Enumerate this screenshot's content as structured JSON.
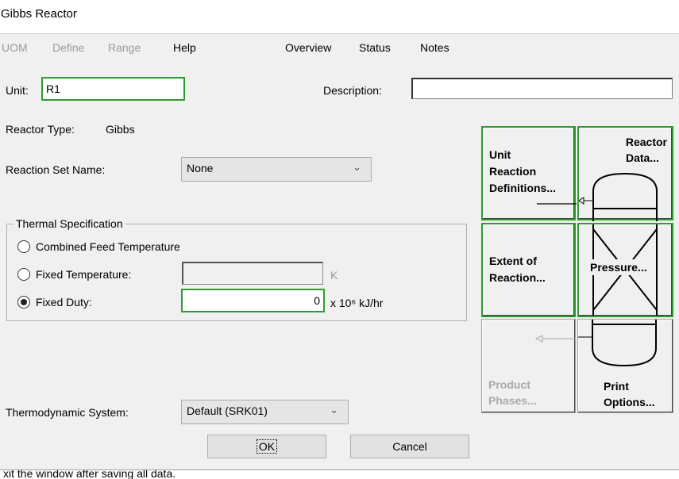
{
  "window": {
    "title": "Gibbs Reactor"
  },
  "menu": {
    "uom": "UOM",
    "define": "Define",
    "range": "Range",
    "help": "Help",
    "overview": "Overview",
    "status": "Status",
    "notes": "Notes"
  },
  "form": {
    "unit_label": "Unit:",
    "unit_value": "R1",
    "description_label": "Description:",
    "description_value": "",
    "reactor_type_label": "Reactor Type:",
    "reactor_type_value": "Gibbs",
    "reaction_set_label": "Reaction Set Name:",
    "reaction_set_value": "None",
    "thermo_label": "Thermodynamic System:",
    "thermo_value": "Default (SRK01)"
  },
  "thermal": {
    "group_label": "Thermal Specification",
    "combined_feed": "Combined Feed Temperature",
    "fixed_temp": "Fixed Temperature:",
    "fixed_temp_value": "",
    "fixed_temp_unit": "K",
    "fixed_duty": "Fixed Duty:",
    "fixed_duty_value": "0",
    "fixed_duty_unit": "x 10⁶ kJ/hr",
    "selected": "fixed_duty"
  },
  "buttons": {
    "ok": "OK",
    "cancel": "Cancel"
  },
  "tiles": {
    "unit_reaction": [
      "Unit",
      "Reaction",
      "Definitions..."
    ],
    "reactor_data": [
      "Reactor",
      "Data..."
    ],
    "extent": [
      "Extent of",
      "Reaction..."
    ],
    "pressure": "Pressure...",
    "product_phases": [
      "Product",
      "Phases..."
    ],
    "print_options": [
      "Print",
      "Options..."
    ]
  },
  "statusbar": {
    "text": "xit the window after saving all data."
  },
  "colors": {
    "accent_border": "#2e9b2e",
    "disabled_text": "#9a9a9a",
    "panel_bg": "#f0f0f0"
  }
}
